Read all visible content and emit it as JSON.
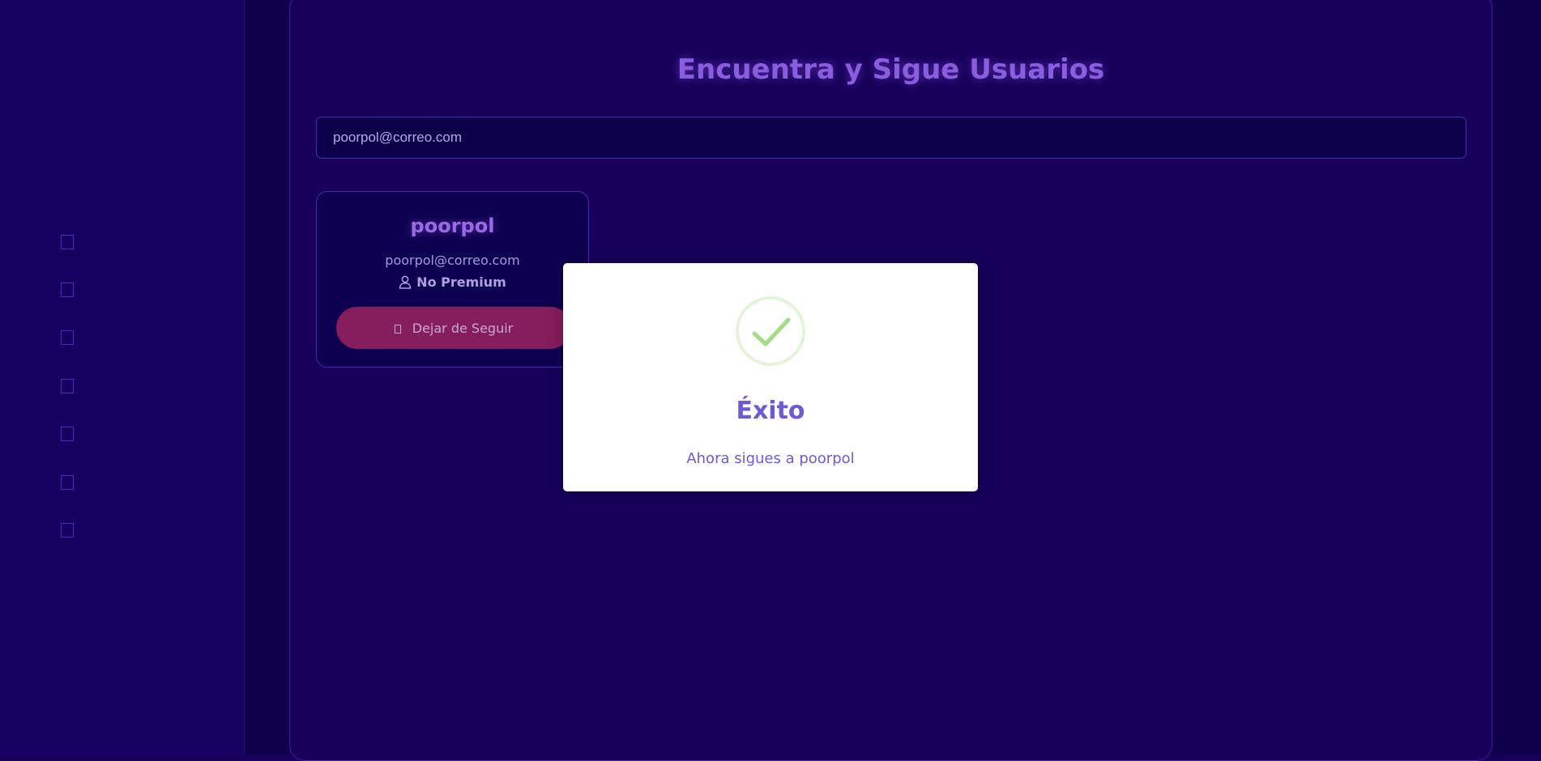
{
  "page": {
    "title": "Encuentra y Sigue Usuarios"
  },
  "sidebar": {
    "items": [
      {
        "icon": "nav-icon-1"
      },
      {
        "icon": "nav-icon-2"
      },
      {
        "icon": "nav-icon-3"
      },
      {
        "icon": "nav-icon-4"
      },
      {
        "icon": "nav-icon-5"
      },
      {
        "icon": "nav-icon-6"
      },
      {
        "icon": "nav-icon-7"
      }
    ]
  },
  "search": {
    "value": "poorpol@correo.com",
    "placeholder": ""
  },
  "results": [
    {
      "username": "poorpol",
      "email": "poorpol@correo.com",
      "plan": "No Premium",
      "plan_icon": "person-icon",
      "action_label": "Dejar de Seguir",
      "action_icon": "unfollow-icon"
    }
  ],
  "modal": {
    "icon": "check-circle-icon",
    "title": "Éxito",
    "message": "Ahora sigues a poorpol"
  },
  "colors": {
    "background": "#16005a",
    "sidebar": "#160060",
    "accent": "#8a5ce0",
    "button": "#861d5d",
    "success": "#a5dc86",
    "modal_text": "#6c5bd6"
  }
}
